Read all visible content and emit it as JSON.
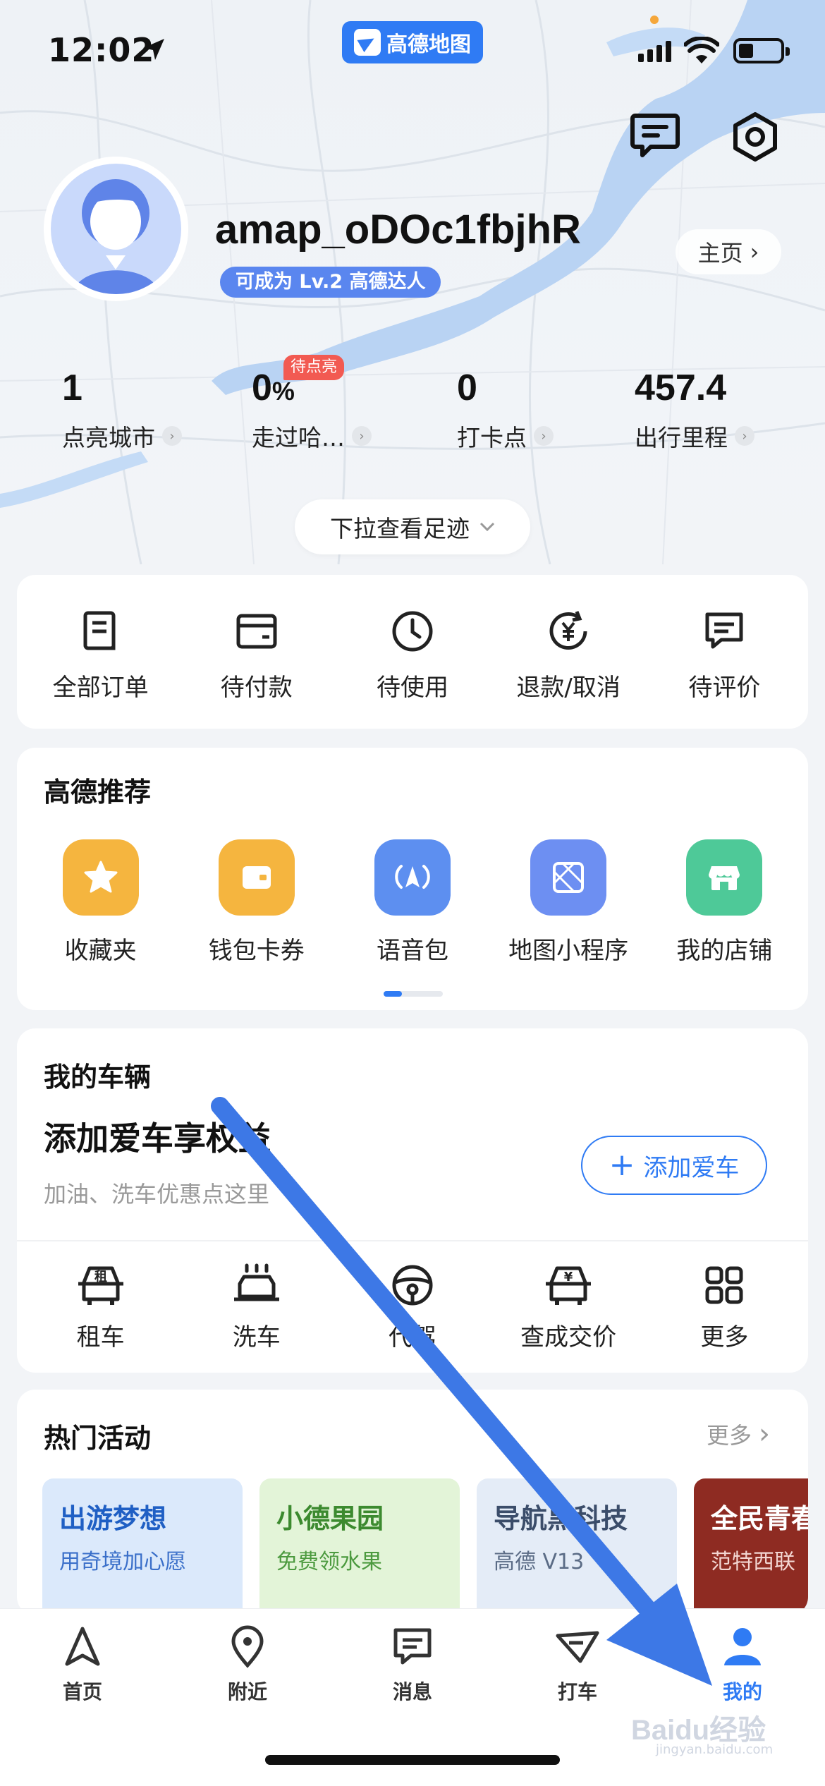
{
  "status_bar": {
    "time": "12:02",
    "app_name": "高德地图"
  },
  "profile": {
    "username": "amap_oDOc1fbjhR",
    "level_badge": "可成为 Lv.2 高德达人",
    "home_button": "主页"
  },
  "stats": [
    {
      "value": "1",
      "suffix": "",
      "label": "点亮城市"
    },
    {
      "value": "0",
      "suffix": "%",
      "label": "走过哈…",
      "badge": "待点亮"
    },
    {
      "value": "0",
      "suffix": "",
      "label": "打卡点"
    },
    {
      "value": "457.4",
      "suffix": "",
      "label": "出行里程"
    }
  ],
  "pull_button": "下拉查看足迹",
  "orders": [
    {
      "label": "全部订单",
      "icon": "order-list-icon"
    },
    {
      "label": "待付款",
      "icon": "wallet-icon"
    },
    {
      "label": "待使用",
      "icon": "clock-icon"
    },
    {
      "label": "退款/取消",
      "icon": "refund-icon"
    },
    {
      "label": "待评价",
      "icon": "comment-icon"
    }
  ],
  "recommend": {
    "title": "高德推荐",
    "items": [
      {
        "label": "收藏夹",
        "icon": "star-icon",
        "color": "#f5b53f"
      },
      {
        "label": "钱包卡券",
        "icon": "wallet-card-icon",
        "color": "#f5b53f"
      },
      {
        "label": "语音包",
        "icon": "voice-pack-icon",
        "color": "#5d8ff0"
      },
      {
        "label": "地图小程序",
        "icon": "mini-program-icon",
        "color": "#6d8ff2"
      },
      {
        "label": "我的店铺",
        "icon": "store-icon",
        "color": "#4ec998"
      }
    ]
  },
  "vehicle": {
    "title": "我的车辆",
    "headline": "添加爱车享权益",
    "subtitle": "加油、洗车优惠点这里",
    "add_button": "添加爱车",
    "services": [
      {
        "label": "租车",
        "icon": "rent-car-icon"
      },
      {
        "label": "洗车",
        "icon": "car-wash-icon"
      },
      {
        "label": "代驾",
        "icon": "steering-wheel-icon"
      },
      {
        "label": "查成交价",
        "icon": "car-price-icon"
      },
      {
        "label": "更多",
        "icon": "grid-more-icon"
      }
    ]
  },
  "activities": {
    "title": "热门活动",
    "more": "更多",
    "cards": [
      {
        "title": "出游梦想",
        "subtitle": "用奇境加心愿",
        "bg": "#dbe9fb",
        "fg": "#1f5fc4",
        "sub_fg": "#3a6fc9"
      },
      {
        "title": "小德果园",
        "subtitle": "免费领水果",
        "bg": "#e3f4d8",
        "fg": "#3c8a2f",
        "sub_fg": "#4c9a3f"
      },
      {
        "title": "导航黑科技",
        "subtitle": "高德 V13",
        "bg": "#e4ecf7",
        "fg": "#3b4d6a",
        "sub_fg": "#5b6c86"
      },
      {
        "title": "全民青春",
        "subtitle": "范特西联",
        "bg": "#8e2b22",
        "fg": "#ffffff",
        "sub_fg": "#f3d6d2"
      }
    ]
  },
  "tabs": [
    {
      "label": "首页",
      "icon": "navigate-icon",
      "active": false
    },
    {
      "label": "附近",
      "icon": "location-pin-icon",
      "active": false
    },
    {
      "label": "消息",
      "icon": "message-icon",
      "active": false
    },
    {
      "label": "打车",
      "icon": "taxi-icon",
      "active": false
    },
    {
      "label": "我的",
      "icon": "person-icon",
      "active": true
    }
  ],
  "watermark": {
    "text": "Baidu经验",
    "sub": "jingyan.baidu.com"
  },
  "colors": {
    "accent": "#2f7bf4",
    "annotation_arrow": "#3d78e6"
  }
}
